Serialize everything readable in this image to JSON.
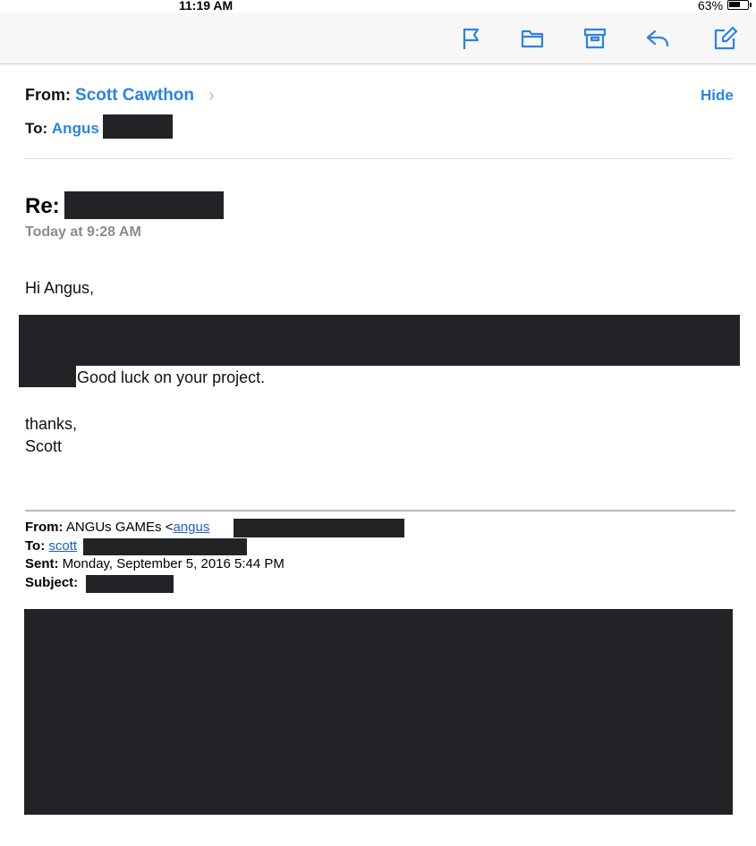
{
  "status": {
    "time": "11:19 AM",
    "battery_percent": "63%",
    "battery_level": 0.63
  },
  "toolbar": {
    "icons": [
      "flag-icon",
      "folder-icon",
      "archive-icon",
      "reply-icon",
      "compose-icon"
    ],
    "accent": "#2a84e0"
  },
  "header": {
    "from_label": "From:",
    "from_name": "Scott Cawthon",
    "hide_label": "Hide",
    "to_label": "To:",
    "to_name": "Angus"
  },
  "message": {
    "subject_prefix": "Re:",
    "date": "Today at 9:28 AM",
    "greeting": "Hi Angus,",
    "line": "Good luck on your project.",
    "signoff": "thanks,",
    "signature": "Scott"
  },
  "quoted": {
    "from_label": "From:",
    "from_name": "ANGUs GAMEs <",
    "from_email": "angus",
    "to_label": "To:",
    "to_email": "scott",
    "sent_label": "Sent:",
    "sent_value": "Monday, September 5, 2016 5:44 PM",
    "subject_label": "Subject:"
  }
}
